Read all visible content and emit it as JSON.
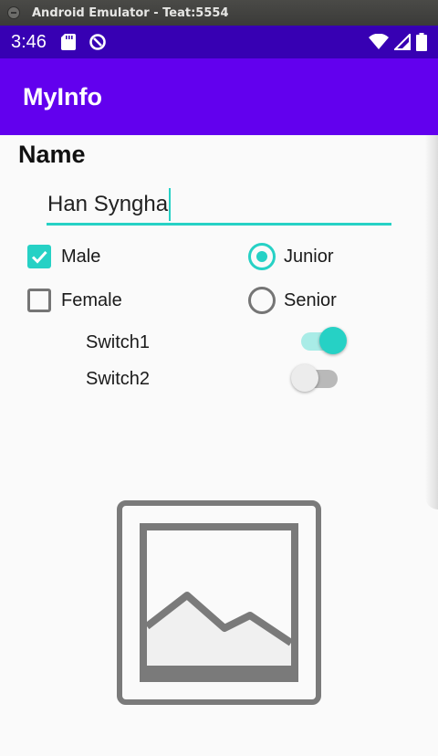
{
  "window": {
    "title": "Android Emulator - Teat:5554"
  },
  "statusbar": {
    "time": "3:46",
    "icons": [
      "sd-card-icon",
      "sync-icon",
      "wifi-icon",
      "cell-signal-icon",
      "battery-icon"
    ]
  },
  "appbar": {
    "title": "MyInfo"
  },
  "form": {
    "name_label": "Name",
    "name_value": "Han Syngha",
    "gender": [
      {
        "label": "Male",
        "checked": true
      },
      {
        "label": "Female",
        "checked": false
      }
    ],
    "level": [
      {
        "label": "Junior",
        "selected": true
      },
      {
        "label": "Senior",
        "selected": false
      }
    ],
    "switches": [
      {
        "label": "Switch1",
        "on": true
      },
      {
        "label": "Switch2",
        "on": false
      }
    ]
  },
  "image": {
    "icon": "image-placeholder-icon"
  },
  "colors": {
    "status_bar": "#3700b3",
    "app_bar": "#6200ee",
    "accent": "#26d1c5",
    "background": "#fafafa"
  }
}
